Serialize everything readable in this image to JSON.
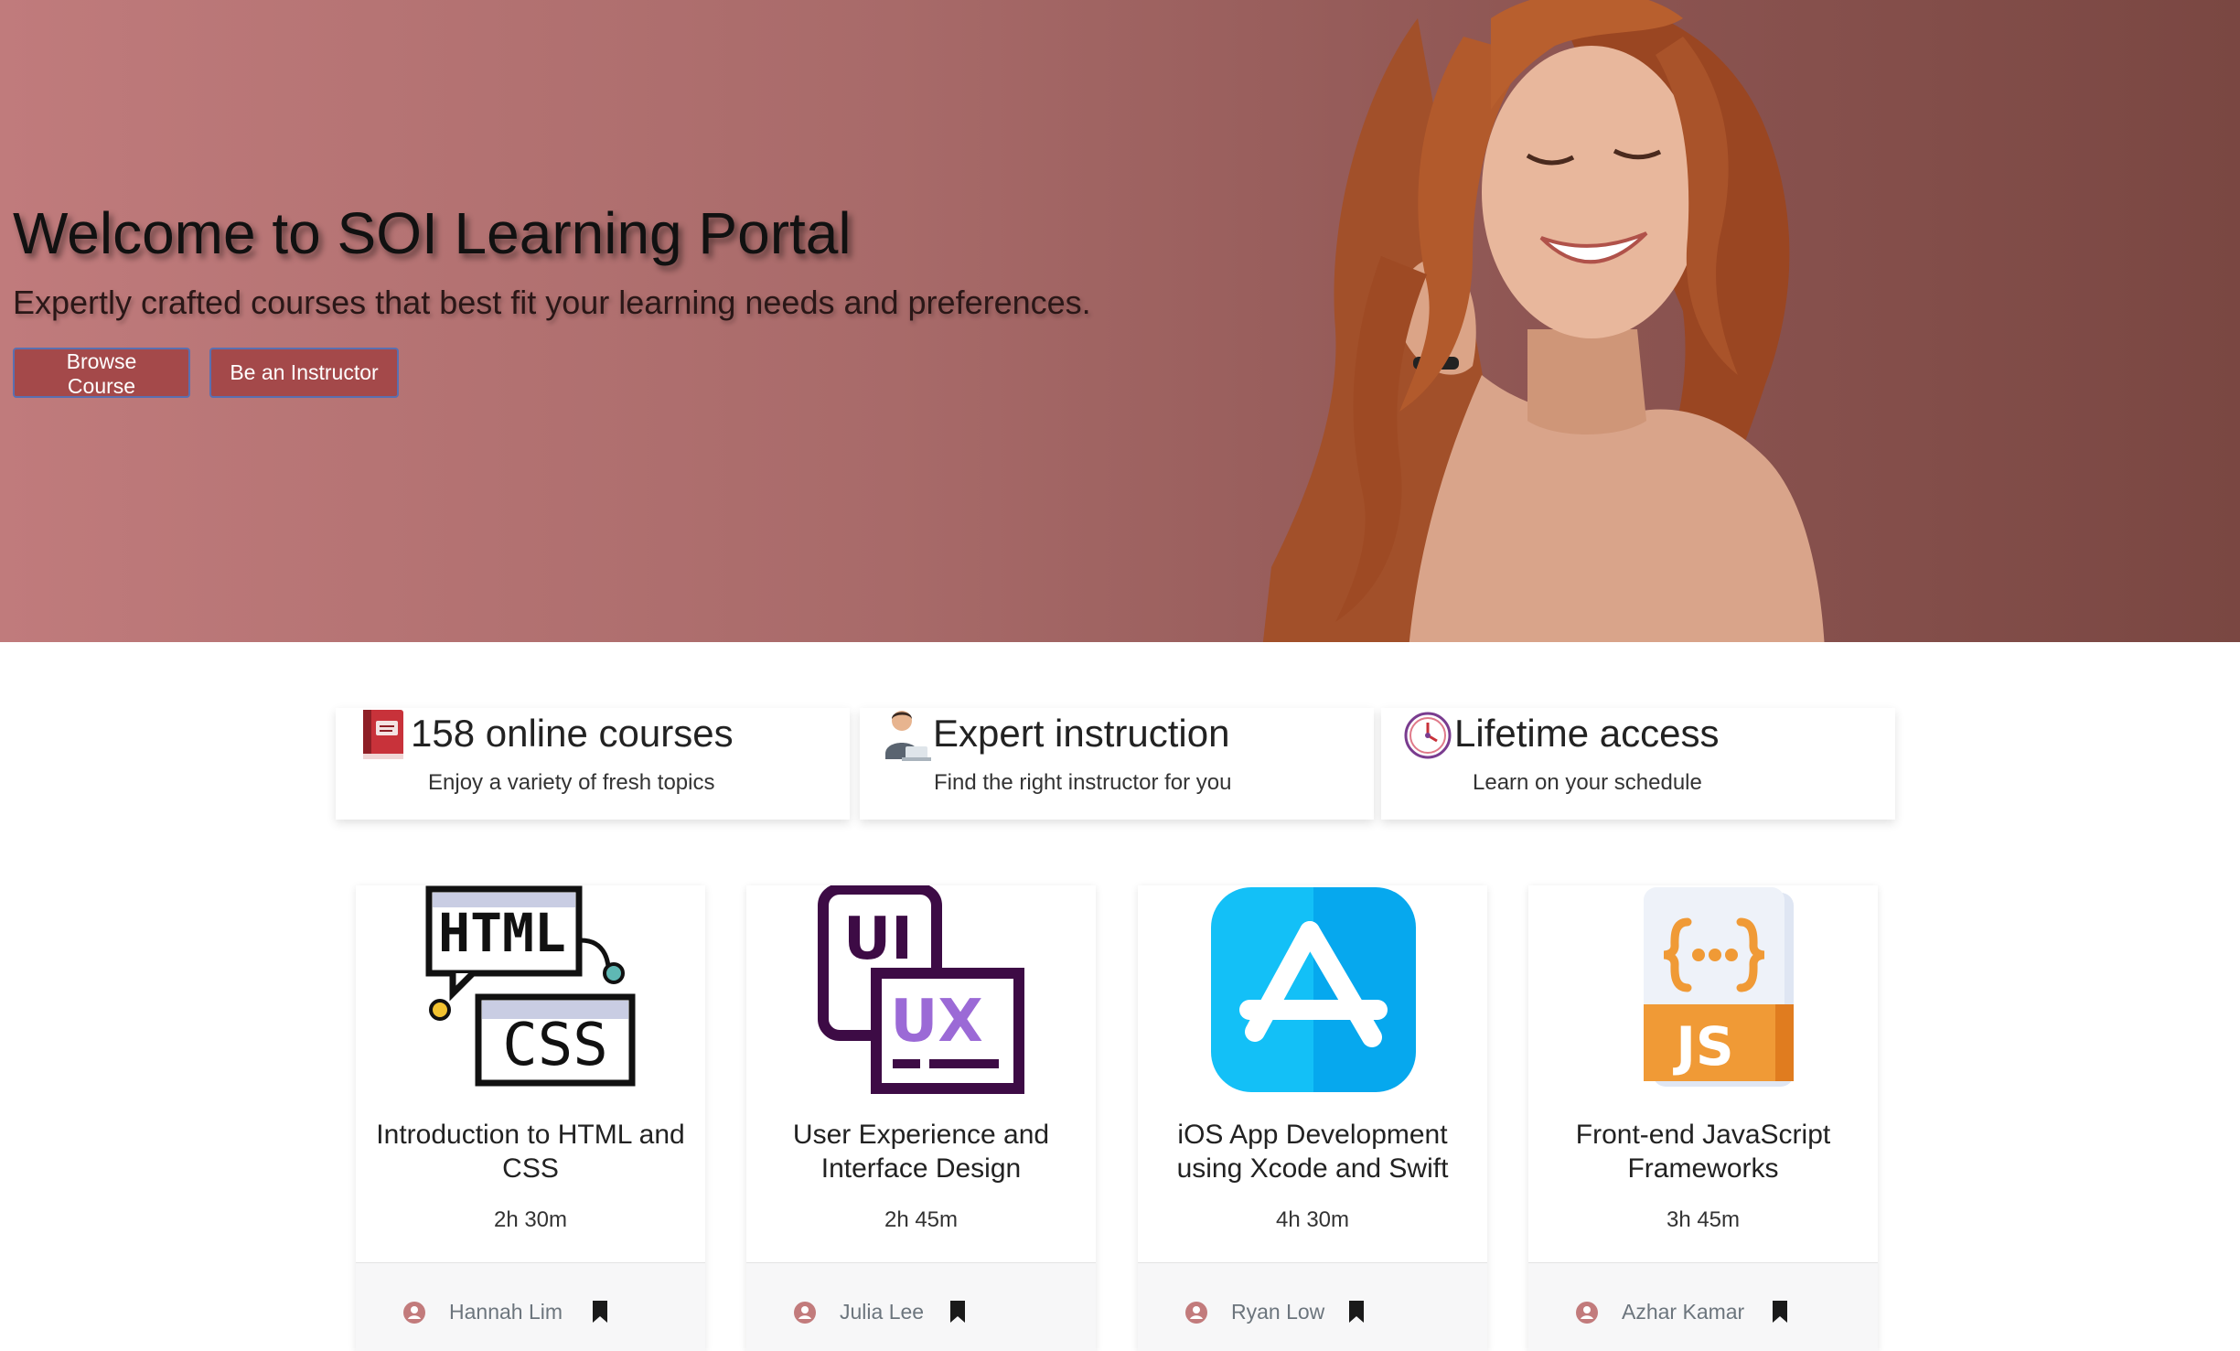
{
  "hero": {
    "title": "Welcome to SOI Learning Portal",
    "subtitle": "Expertly crafted courses that best fit your learning needs and preferences.",
    "buttons": [
      {
        "label": "Browse Course"
      },
      {
        "label": "Be an Instructor"
      }
    ]
  },
  "features": [
    {
      "icon": "book-icon",
      "title": "158 online courses",
      "desc": "Enjoy a variety of fresh topics"
    },
    {
      "icon": "instructor-icon",
      "title": "Expert instruction",
      "desc": "Find the right instructor for you"
    },
    {
      "icon": "clock-icon",
      "title": "Lifetime access",
      "desc": "Learn on your schedule"
    }
  ],
  "courses": [
    {
      "icon": "html-css-icon",
      "title": "Introduction to HTML and CSS",
      "duration": "2h 30m",
      "instructor": "Hannah Lim"
    },
    {
      "icon": "ui-ux-icon",
      "title": "User Experience and Interface Design",
      "duration": "2h 45m",
      "instructor": "Julia Lee"
    },
    {
      "icon": "app-store-icon",
      "title": "iOS App Development using Xcode and Swift",
      "duration": "4h 30m",
      "instructor": "Ryan Low"
    },
    {
      "icon": "javascript-icon",
      "title": "Front-end JavaScript Frameworks",
      "duration": "3h 45m",
      "instructor": "Azhar Kamar"
    }
  ],
  "colors": {
    "hero_start": "#c07b7c",
    "hero_end": "#7a4742",
    "button_bg": "#a4494a",
    "button_border": "#5a6fb0",
    "muted_text": "#6c757d",
    "footer_bg": "#f7f7f8"
  }
}
